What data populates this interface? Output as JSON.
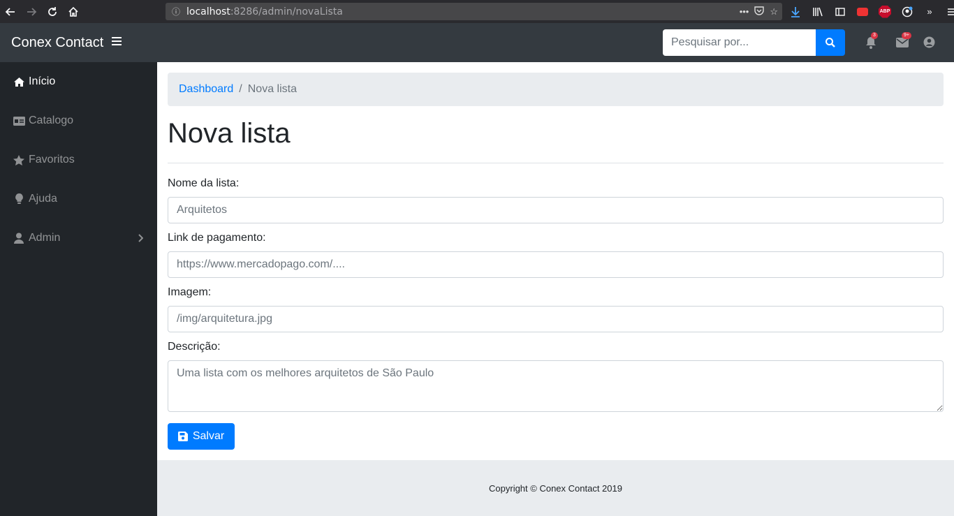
{
  "browser": {
    "url_host": "localhost",
    "url_rest": ":8286/admin/novaLista"
  },
  "navbar": {
    "brand": "Conex Contact",
    "search_placeholder": "Pesquisar por...",
    "notifications_count": "3",
    "messages_count": "9+"
  },
  "sidebar": {
    "items": [
      {
        "label": "Início",
        "icon": "home-icon"
      },
      {
        "label": "Catalogo",
        "icon": "id-card-icon"
      },
      {
        "label": "Favoritos",
        "icon": "star-icon"
      },
      {
        "label": "Ajuda",
        "icon": "lightbulb-icon"
      },
      {
        "label": "Admin",
        "icon": "user-icon"
      }
    ]
  },
  "breadcrumb": {
    "link": "Dashboard",
    "current": "Nova lista"
  },
  "page": {
    "title": "Nova lista"
  },
  "form": {
    "name_label": "Nome da lista:",
    "name_placeholder": "Arquitetos",
    "link_label": "Link de pagamento:",
    "link_placeholder": "https://www.mercadopago.com/....",
    "image_label": "Imagem:",
    "image_placeholder": "/img/arquitetura.jpg",
    "desc_label": "Descrição:",
    "desc_placeholder": "Uma lista com os melhores arquitetos de São Paulo",
    "save_label": "Salvar"
  },
  "footer": {
    "text": "Copyright © Conex Contact 2019"
  },
  "colors": {
    "primary": "#007bff",
    "navbar": "#343a40",
    "sidebar": "#212529",
    "badge": "#dc3545"
  }
}
